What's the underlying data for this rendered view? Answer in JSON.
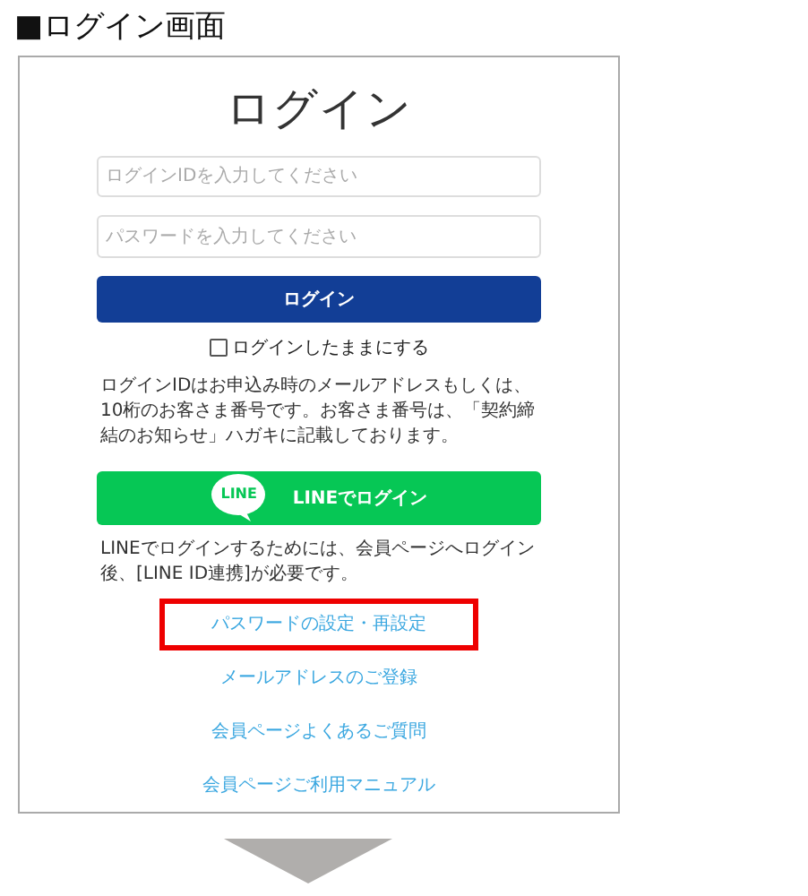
{
  "heading": "■ログイン画面",
  "login": {
    "title": "ログイン",
    "fields": [
      {
        "placeholder": "ログインIDを入力してください"
      },
      {
        "placeholder": "パスワードを入力してください"
      }
    ],
    "login_button": "ログイン",
    "remember": {
      "label": "ログインしたままにする",
      "checked": false
    },
    "id_note": "ログインIDはお申込み時のメールアドレスもしくは、10桁のお客さま番号です。お客さま番号は、「契約締結のお知らせ」ハガキに記載しております。",
    "line_button": {
      "logo_text": "LINE",
      "label": "LINEでログイン"
    },
    "line_note": "LINEでログインするためには、会員ページへログイン後、[LINE ID連携]が必要です。",
    "links": [
      {
        "label": "パスワードの設定・再設定",
        "highlighted": true
      },
      {
        "label": "メールアドレスのご登録",
        "highlighted": false
      },
      {
        "label": "会員ページよくあるご質問",
        "highlighted": false
      },
      {
        "label": "会員ページご利用マニュアル",
        "highlighted": false
      }
    ]
  }
}
